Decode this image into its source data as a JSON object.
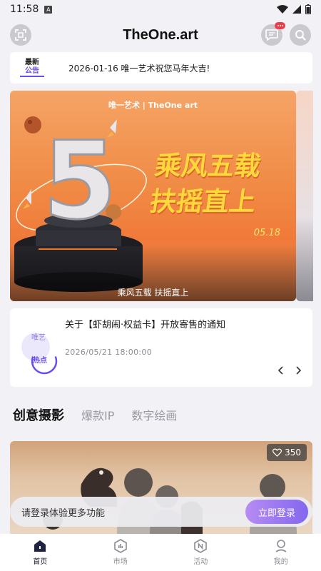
{
  "status_bar": {
    "time": "11:58",
    "notification_icon": "a-icon",
    "indicators": [
      "wifi-icon",
      "signal-icon",
      "battery-icon"
    ]
  },
  "header": {
    "title": "TheOne.art",
    "left_icon": "scan-icon",
    "right_icons": [
      "message-icon",
      "search-icon"
    ],
    "message_badge": "···"
  },
  "notice": {
    "tag_line1": "最新",
    "tag_line2": "公告",
    "text": "2026-01-16 唯一艺术祝您马年大吉!"
  },
  "banner": {
    "brand": "唯一艺术 | TheOne art",
    "number": "5",
    "headline_line1": "乘风五载",
    "headline_line2": "扶摇直上",
    "date": "05.18",
    "caption": "乘风五载 扶摇直上"
  },
  "news": {
    "icon_top": "唯艺",
    "icon_bottom": "热点",
    "title": "关于【虾胡闹·权益卡】开放寄售的通知",
    "datetime": "2026/05/21 18:00:00",
    "prev_icon": "chevron-left-icon",
    "next_icon": "chevron-right-icon"
  },
  "categories": {
    "tabs": [
      "创意摄影",
      "爆款IP",
      "数字绘画"
    ],
    "active": "创意摄影"
  },
  "art_card": {
    "likes": "350",
    "like_icon": "heart-icon"
  },
  "login_prompt": {
    "text": "请登录体验更多功能",
    "button": "立即登录"
  },
  "bottom_nav": {
    "items": [
      {
        "label": "首页",
        "icon": "home-icon",
        "active": true
      },
      {
        "label": "市场",
        "icon": "market-icon",
        "active": false
      },
      {
        "label": "活动",
        "icon": "activity-icon",
        "active": false
      },
      {
        "label": "我的",
        "icon": "profile-icon",
        "active": false
      }
    ]
  },
  "colors": {
    "accent": "#8467ee",
    "badge": "#ef3b4a",
    "banner_orange": "#f08b45",
    "headline_yellow": "#ffd93b"
  }
}
